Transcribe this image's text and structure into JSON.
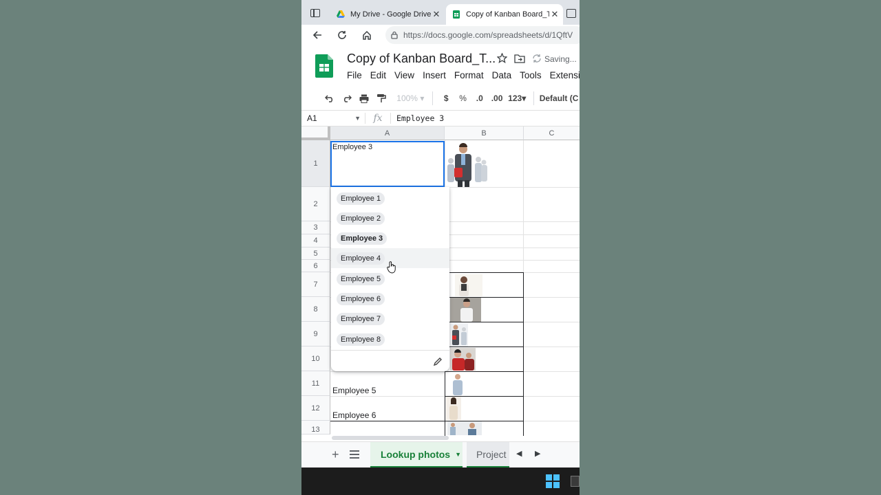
{
  "browser": {
    "tabs": [
      {
        "title": "My Drive - Google Drive",
        "active": false
      },
      {
        "title": "Copy of Kanban Board_Te",
        "active": true
      }
    ],
    "url": "https://docs.google.com/spreadsheets/d/1QftV"
  },
  "sheet": {
    "title": "Copy of Kanban Board_T...",
    "save_status": "Saving...",
    "menu": [
      "File",
      "Edit",
      "View",
      "Insert",
      "Format",
      "Data",
      "Tools",
      "Extensio"
    ],
    "toolbar": {
      "zoom": "100%",
      "currency": "$",
      "percent": "%",
      "dec_decrease": ".0",
      "dec_increase": ".00",
      "number_format": "123",
      "font": "Default (C"
    },
    "name_box": "A1",
    "fx_label": "fx",
    "formula_value": "Employee 3",
    "columns": [
      "A",
      "B",
      "C"
    ],
    "rows": [
      "1",
      "2",
      "3",
      "4",
      "5",
      "6",
      "7",
      "8",
      "9",
      "10",
      "11",
      "12",
      "13"
    ],
    "cells": {
      "A1": "Employee 3",
      "A11": "Employee 5",
      "A12": "Employee 6"
    },
    "dropdown_options": [
      "Employee 1",
      "Employee 2",
      "Employee 3",
      "Employee 4",
      "Employee 5",
      "Employee 6",
      "Employee 7",
      "Employee 8"
    ],
    "dropdown_selected": "Employee 3",
    "dropdown_hovered": "Employee 4",
    "sheet_tabs": [
      "Lookup photos",
      "Project"
    ]
  },
  "colors": {
    "accent_green": "#188038",
    "selection_blue": "#1a73e8",
    "background": "#6b827b"
  }
}
